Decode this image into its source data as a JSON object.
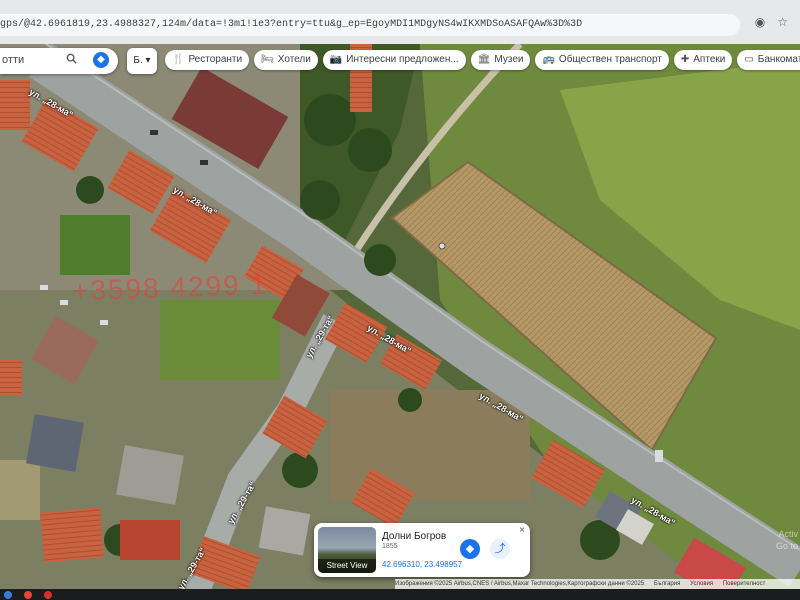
{
  "browser": {
    "url": "gps/@42.6961819,23.4988327,124m/data=!3m1!1e3?entry=ttu&g_ep=EgoyMDI1MDgyNS4wIKXMDSoASAFQAw%3D%3D",
    "icons": [
      "location-icon",
      "star-icon"
    ]
  },
  "search": {
    "text": "отти",
    "icon": "search-icon"
  },
  "layers_label": "Б.",
  "chips": [
    {
      "name": "restaurants",
      "label": "Ресторанти",
      "icon": "🍴"
    },
    {
      "name": "hotels",
      "label": "Хотели",
      "icon": "🛏"
    },
    {
      "name": "attractions",
      "label": "Интересни предложен...",
      "icon": "📷"
    },
    {
      "name": "museums",
      "label": "Музеи",
      "icon": "🏛"
    },
    {
      "name": "transit",
      "label": "Обществен транспорт",
      "icon": "🚌"
    },
    {
      "name": "pharmacies",
      "label": "Аптеки",
      "icon": "✚"
    },
    {
      "name": "atms",
      "label": "Банкомати",
      "icon": "▭"
    }
  ],
  "streets": {
    "street_28_a": "ул. „28-ма“",
    "street_28_b": "ул. „28-ма“",
    "street_28_c": "ул. „28-ма“",
    "street_28_d": "ул. „28-ма“",
    "street_28_e": "ул. „28-ма“",
    "street_29_a": "ул. „29-та“",
    "street_29_b": "ул. „29-та“",
    "street_29_c": "ул. „29-та“"
  },
  "watermark": "+3598 4299 1",
  "info_card": {
    "thumb_label": "Street View",
    "place_name": "Долни Богров",
    "place_sub": "1855",
    "coords": "42.696310, 23.498957"
  },
  "attribution": {
    "imagery": "Изображения ©2025 Airbus,CNES / Airbus,Maxar Technologies,Картографски данни ©2025",
    "links": [
      "България",
      "Условия",
      "Поверителност"
    ]
  },
  "activate_windows": "Activ\nGo to",
  "colors": {
    "road": "#9ea3a2",
    "field_dry": "#b59866",
    "grass": "#5f7a37",
    "roof_red": "#c8623f",
    "accent_blue": "#1a73e8"
  }
}
